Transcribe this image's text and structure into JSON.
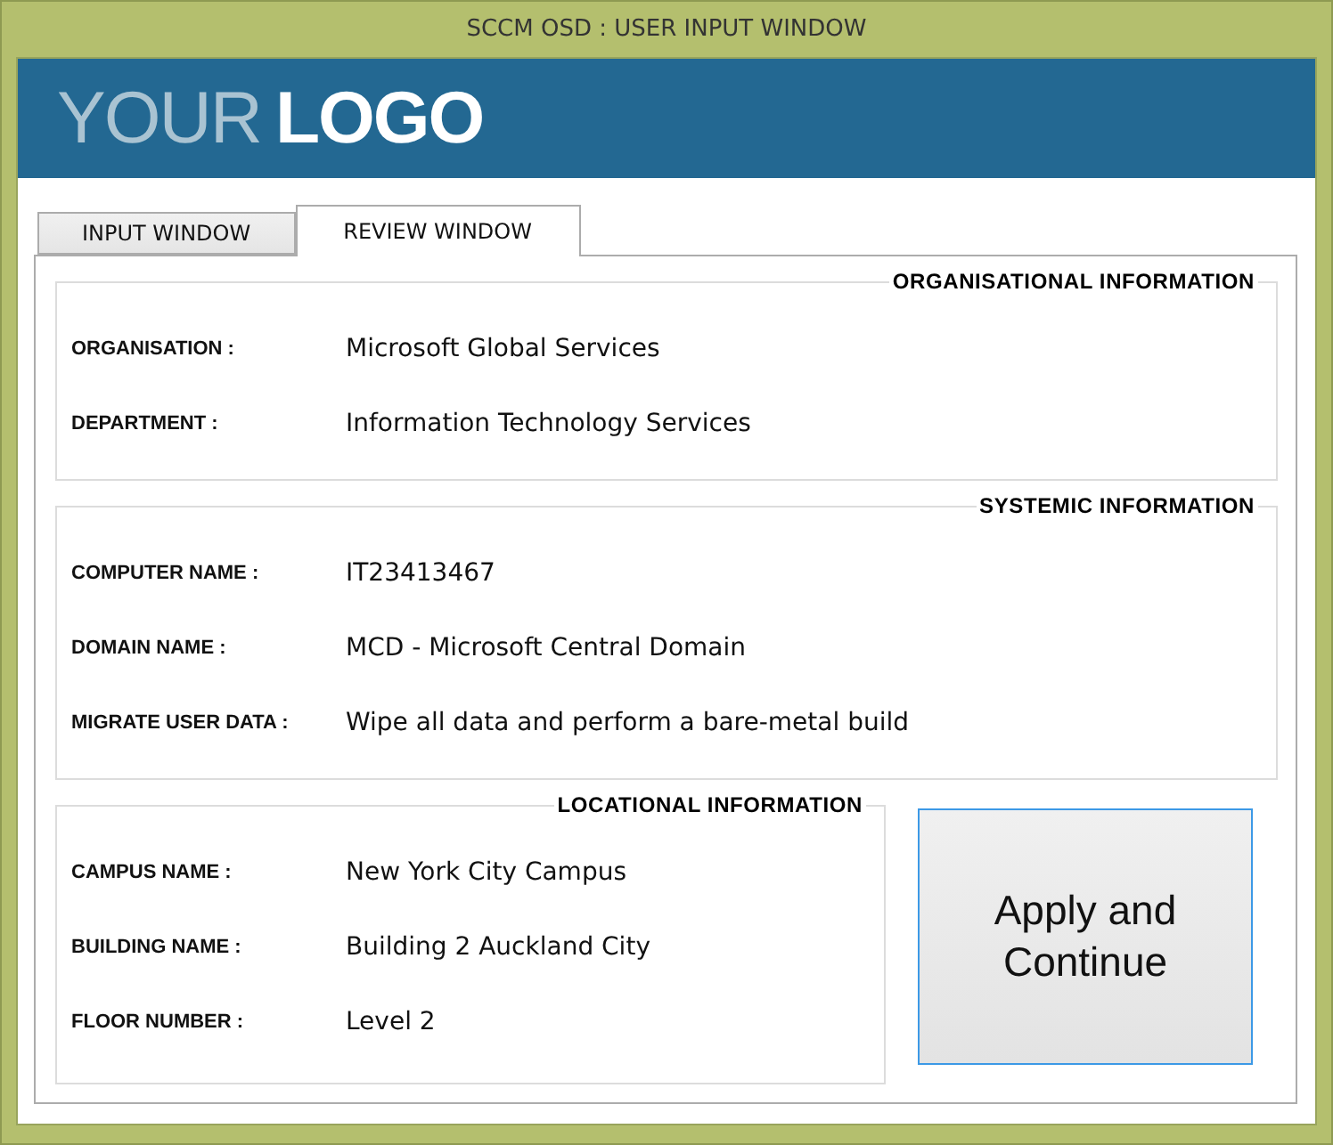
{
  "window": {
    "title": "SCCM OSD : USER INPUT WINDOW"
  },
  "logo": {
    "light": "YOUR",
    "bold": "LOGO"
  },
  "tabs": [
    {
      "label": "INPUT WINDOW",
      "selected": false
    },
    {
      "label": "REVIEW WINDOW",
      "selected": true
    }
  ],
  "groups": [
    {
      "title": "ORGANISATIONAL INFORMATION",
      "fields": [
        {
          "label": "ORGANISATION :",
          "value": "Microsoft Global Services"
        },
        {
          "label": "DEPARTMENT :",
          "value": "Information Technology Services"
        }
      ]
    },
    {
      "title": "SYSTEMIC INFORMATION",
      "fields": [
        {
          "label": "COMPUTER NAME :",
          "value": "IT23413467"
        },
        {
          "label": "DOMAIN NAME :",
          "value": "MCD - Microsoft Central Domain"
        },
        {
          "label": "MIGRATE USER DATA :",
          "value": "Wipe all data and perform a bare-metal build"
        }
      ]
    },
    {
      "title": "LOCATIONAL INFORMATION",
      "fields": [
        {
          "label": "CAMPUS NAME :",
          "value": "New York City Campus"
        },
        {
          "label": "BUILDING NAME :",
          "value": "Building 2 Auckland City"
        },
        {
          "label": "FLOOR NUMBER :",
          "value": "Level 2"
        }
      ]
    }
  ],
  "button": {
    "label": "Apply and Continue"
  }
}
